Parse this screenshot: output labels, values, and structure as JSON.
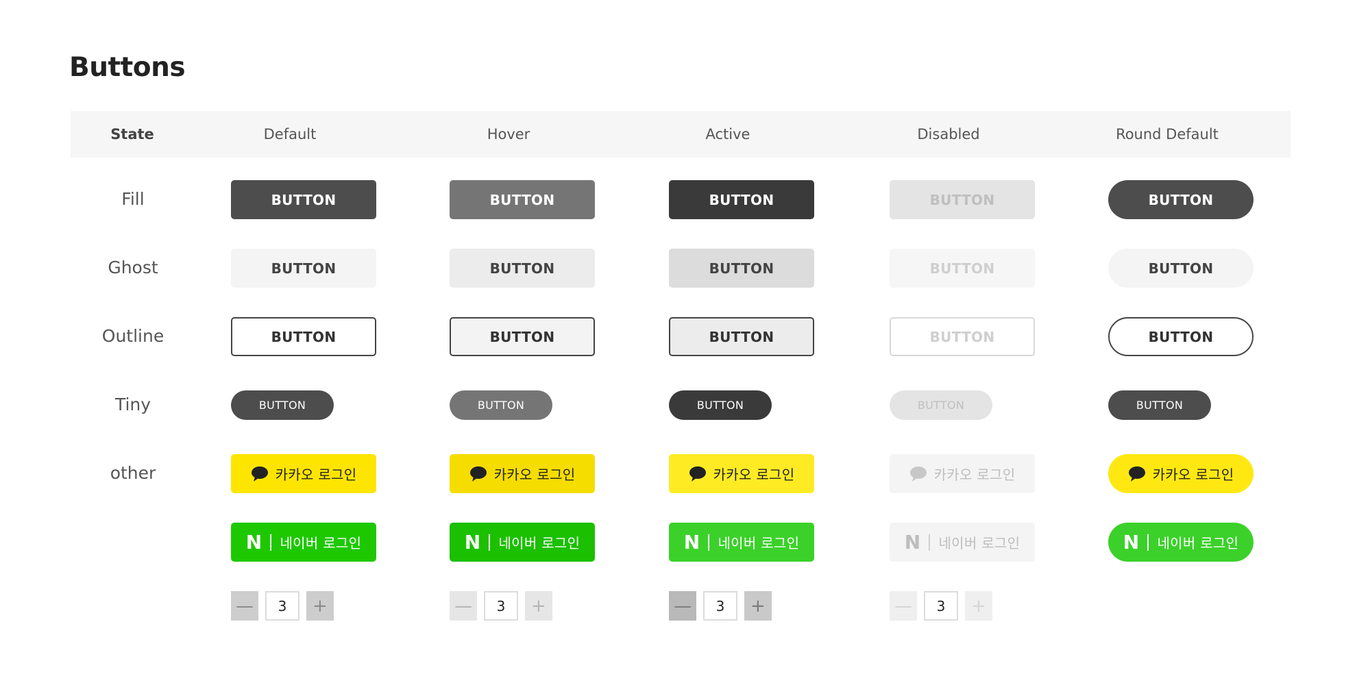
{
  "title": "Buttons",
  "header": {
    "state": "State",
    "columns": [
      "Default",
      "Hover",
      "Active",
      "Disabled",
      "Round Default"
    ]
  },
  "rows": {
    "fill": "Fill",
    "ghost": "Ghost",
    "outline": "Outline",
    "tiny": "Tiny",
    "other": "other"
  },
  "button_label": "BUTTON",
  "kakao_label": "카카오 로그인",
  "naver_label": "네이버 로그인",
  "naver_logo": "N",
  "stepper": {
    "value": "3",
    "minus": "—",
    "plus": "+"
  },
  "colors": {
    "kakao": "#fee500",
    "naver": "#1ec800",
    "fill_default": "#4d4d4d"
  }
}
